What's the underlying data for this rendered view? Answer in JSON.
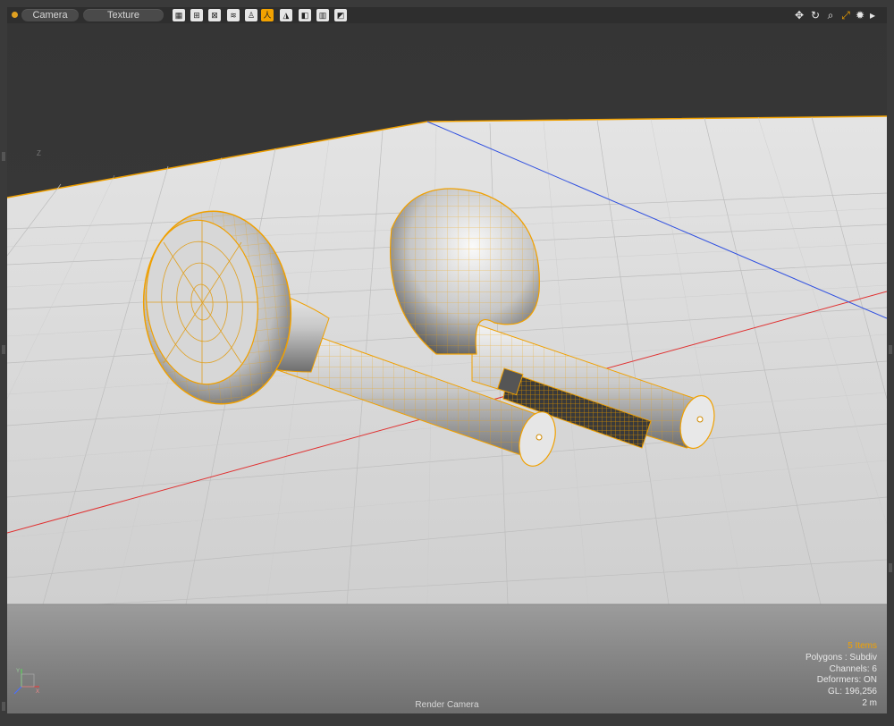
{
  "toolbar": {
    "camera_label": "Camera",
    "texture_label": "Texture",
    "buttons": [
      "checker-icon",
      "nodes-icon",
      "wire-box-icon",
      "hatch-icon",
      "figure-icon",
      "person-icon",
      "shade-icon",
      "texture-icon",
      "diag-icon"
    ],
    "active_button": "figure-icon",
    "right_tools": [
      "move-icon",
      "rotate-icon",
      "zoom-icon",
      "fit-icon",
      "settings-icon",
      "more-icon"
    ]
  },
  "viewport": {
    "axis_hint": "Z",
    "info": {
      "items": "5 Items",
      "polygons": "Polygons : Subdiv",
      "channels": "Channels: 6",
      "deformers": "Deformers: ON",
      "gl": "GL: 196,256",
      "scale": "2 m"
    },
    "camera_name": "Render Camera"
  },
  "colors": {
    "accent": "#f2a200",
    "grid_bg": "#d9d9d9",
    "x_axis": "#e03030",
    "z_axis": "#3050e0",
    "wire": "#f0a000"
  }
}
